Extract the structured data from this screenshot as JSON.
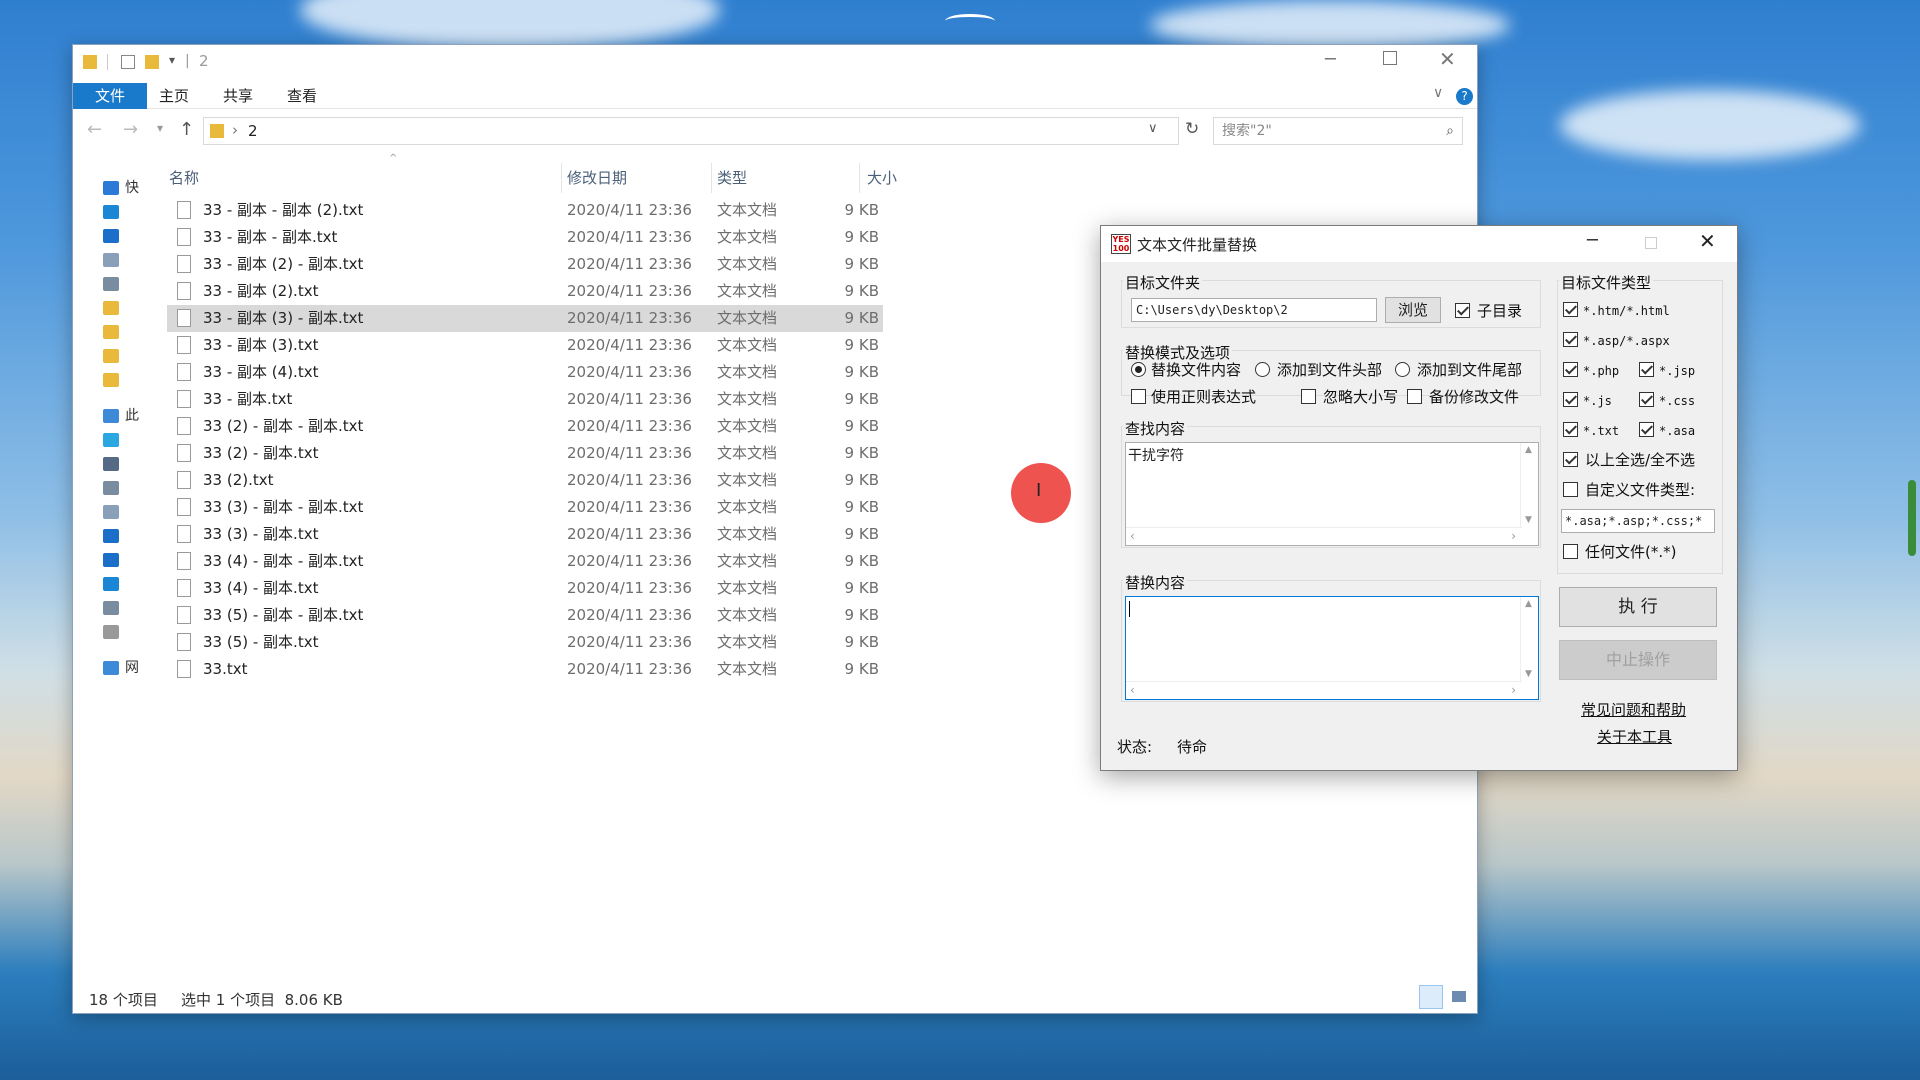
{
  "explorer": {
    "title": "2",
    "tabs": [
      "文件",
      "主页",
      "共享",
      "查看"
    ],
    "address": "2",
    "search_placeholder": "搜索\"2\"",
    "columns": {
      "name": "名称",
      "date": "修改日期",
      "type": "类型",
      "size": "大小"
    },
    "files": [
      {
        "name": "33 - 副本 - 副本 (2).txt",
        "date": "2020/4/11 23:36",
        "type": "文本文档",
        "size": "9 KB",
        "selected": false
      },
      {
        "name": "33 - 副本 - 副本.txt",
        "date": "2020/4/11 23:36",
        "type": "文本文档",
        "size": "9 KB",
        "selected": false
      },
      {
        "name": "33 - 副本 (2) - 副本.txt",
        "date": "2020/4/11 23:36",
        "type": "文本文档",
        "size": "9 KB",
        "selected": false
      },
      {
        "name": "33 - 副本 (2).txt",
        "date": "2020/4/11 23:36",
        "type": "文本文档",
        "size": "9 KB",
        "selected": false
      },
      {
        "name": "33 - 副本 (3) - 副本.txt",
        "date": "2020/4/11 23:36",
        "type": "文本文档",
        "size": "9 KB",
        "selected": true
      },
      {
        "name": "33 - 副本 (3).txt",
        "date": "2020/4/11 23:36",
        "type": "文本文档",
        "size": "9 KB",
        "selected": false
      },
      {
        "name": "33 - 副本 (4).txt",
        "date": "2020/4/11 23:36",
        "type": "文本文档",
        "size": "9 KB",
        "selected": false
      },
      {
        "name": "33 - 副本.txt",
        "date": "2020/4/11 23:36",
        "type": "文本文档",
        "size": "9 KB",
        "selected": false
      },
      {
        "name": "33 (2) - 副本 - 副本.txt",
        "date": "2020/4/11 23:36",
        "type": "文本文档",
        "size": "9 KB",
        "selected": false
      },
      {
        "name": "33 (2) - 副本.txt",
        "date": "2020/4/11 23:36",
        "type": "文本文档",
        "size": "9 KB",
        "selected": false
      },
      {
        "name": "33 (2).txt",
        "date": "2020/4/11 23:36",
        "type": "文本文档",
        "size": "9 KB",
        "selected": false
      },
      {
        "name": "33 (3) - 副本 - 副本.txt",
        "date": "2020/4/11 23:36",
        "type": "文本文档",
        "size": "9 KB",
        "selected": false
      },
      {
        "name": "33 (3) - 副本.txt",
        "date": "2020/4/11 23:36",
        "type": "文本文档",
        "size": "9 KB",
        "selected": false
      },
      {
        "name": "33 (4) - 副本 - 副本.txt",
        "date": "2020/4/11 23:36",
        "type": "文本文档",
        "size": "9 KB",
        "selected": false
      },
      {
        "name": "33 (4) - 副本.txt",
        "date": "2020/4/11 23:36",
        "type": "文本文档",
        "size": "9 KB",
        "selected": false
      },
      {
        "name": "33 (5) - 副本 - 副本.txt",
        "date": "2020/4/11 23:36",
        "type": "文本文档",
        "size": "9 KB",
        "selected": false
      },
      {
        "name": "33 (5) - 副本.txt",
        "date": "2020/4/11 23:36",
        "type": "文本文档",
        "size": "9 KB",
        "selected": false
      },
      {
        "name": "33.txt",
        "date": "2020/4/11 23:36",
        "type": "文本文档",
        "size": "9 KB",
        "selected": false
      }
    ],
    "nav_items": [
      {
        "label": "快",
        "icon": "star-icon",
        "color": "#2b7bd6"
      },
      {
        "label": "",
        "icon": "desktop-icon",
        "color": "#1b86d6"
      },
      {
        "label": "",
        "icon": "download-icon",
        "color": "#1b6fc9"
      },
      {
        "label": "",
        "icon": "document-icon",
        "color": "#8aa0b8"
      },
      {
        "label": "",
        "icon": "picture-icon",
        "color": "#7a8da0"
      },
      {
        "label": "",
        "icon": "folder-icon",
        "color": "#e8b93a"
      },
      {
        "label": "",
        "icon": "folder-icon",
        "color": "#e8b93a"
      },
      {
        "label": "",
        "icon": "folder-icon",
        "color": "#e8b93a"
      },
      {
        "label": "",
        "icon": "folder-icon",
        "color": "#e8b93a"
      },
      {
        "label": "此",
        "icon": "pc-icon",
        "color": "#3d8ad8"
      },
      {
        "label": "",
        "icon": "3d-objects-icon",
        "color": "#2aa7e0"
      },
      {
        "label": "",
        "icon": "video-icon",
        "color": "#556b85"
      },
      {
        "label": "",
        "icon": "picture-icon",
        "color": "#7a8da0"
      },
      {
        "label": "",
        "icon": "document-icon",
        "color": "#8aa0b8"
      },
      {
        "label": "",
        "icon": "download-icon",
        "color": "#1b6fc9"
      },
      {
        "label": "",
        "icon": "music-icon",
        "color": "#1b6fc9"
      },
      {
        "label": "",
        "icon": "desktop-icon",
        "color": "#1b86d6"
      },
      {
        "label": "",
        "icon": "drive-icon",
        "color": "#7a8da0"
      },
      {
        "label": "",
        "icon": "drive-icon",
        "color": "#9a9a9a"
      },
      {
        "label": "网",
        "icon": "network-icon",
        "color": "#3d8ad8"
      }
    ],
    "status_count": "18 个项目",
    "status_selected": "选中 1 个项目  8.06 KB"
  },
  "dialog": {
    "title": "文本文件批量替换",
    "target_folder_label": "目标文件夹",
    "target_folder_value": "C:\\Users\\dy\\Desktop\\2",
    "browse_label": "浏览",
    "subdir_label": "子目录",
    "subdir_checked": true,
    "mode_label": "替换模式及选项",
    "modes": [
      {
        "label": "替换文件内容",
        "checked": true
      },
      {
        "label": "添加到文件头部",
        "checked": false
      },
      {
        "label": "添加到文件尾部",
        "checked": false
      }
    ],
    "options": [
      {
        "label": "使用正则表达式",
        "checked": false
      },
      {
        "label": "忽略大小写",
        "checked": false
      },
      {
        "label": "备份修改文件",
        "checked": false
      }
    ],
    "find_label": "查找内容",
    "find_value": "干扰字符",
    "replace_label": "替换内容",
    "replace_value": "",
    "status_label": "状态:",
    "status_value": "待命",
    "file_types_label": "目标文件类型",
    "file_types": [
      {
        "label": "*.htm/*.html",
        "checked": true
      },
      {
        "label": "*.asp/*.aspx",
        "checked": true
      },
      {
        "label": "*.php",
        "checked": true
      },
      {
        "label": "*.jsp",
        "checked": true
      },
      {
        "label": "*.js",
        "checked": true
      },
      {
        "label": "*.css",
        "checked": true
      },
      {
        "label": "*.txt",
        "checked": true
      },
      {
        "label": "*.asa",
        "checked": true
      }
    ],
    "select_all_label": "以上全选/全不选",
    "select_all_checked": true,
    "custom_type_label": "自定义文件类型:",
    "custom_type_checked": false,
    "custom_type_value": "*.asa;*.asp;*.css;*",
    "any_file_label": "任何文件(*.*)",
    "any_file_checked": false,
    "execute_label": "执 行",
    "stop_label": "中止操作",
    "help_link": "常见问题和帮助",
    "about_link": "关于本工具"
  },
  "colors": {
    "accent": "#1979ca",
    "selection": "#d9d9d9",
    "cursor_marker": "#ef5350"
  }
}
